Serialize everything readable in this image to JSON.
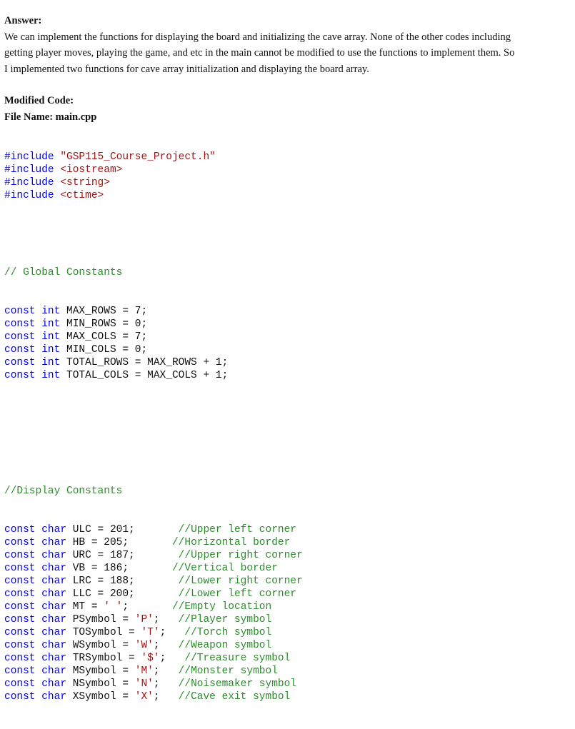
{
  "answer": {
    "heading": "Answer:",
    "paragraph_lines": [
      "We can implement the functions for displaying the board and initializing the cave array. None of the other codes including",
      "getting player moves, playing the game, and etc in the main cannot be modified to use the functions to implement them. So",
      "I implemented two functions for cave array initialization and displaying the board array."
    ]
  },
  "modified": {
    "heading": "Modified Code:",
    "file_name": "File Name: main.cpp"
  },
  "includes": [
    {
      "directive": "#include",
      "target": "\"GSP115_Course_Project.h\""
    },
    {
      "directive": "#include",
      "target": "<iostream>"
    },
    {
      "directive": "#include",
      "target": "<string>"
    },
    {
      "directive": "#include",
      "target": "<ctime>"
    }
  ],
  "global_comment": "// Global Constants",
  "globals": [
    {
      "kw1": "const",
      "kw2": "int",
      "rest": " MAX_ROWS = 7;"
    },
    {
      "kw1": "const",
      "kw2": "int",
      "rest": " MIN_ROWS = 0;"
    },
    {
      "kw1": "const",
      "kw2": "int",
      "rest": " MAX_COLS = 7;"
    },
    {
      "kw1": "const",
      "kw2": "int",
      "rest": " MIN_COLS = 0;"
    },
    {
      "kw1": "const",
      "kw2": "int",
      "rest": " TOTAL_ROWS = MAX_ROWS + 1;"
    },
    {
      "kw1": "const",
      "kw2": "int",
      "rest": " TOTAL_COLS = MAX_COLS + 1;"
    }
  ],
  "display_comment": "//Display Constants",
  "display": [
    {
      "kw1": "const",
      "kw2": "char",
      "pre": " ULC = 201;",
      "lit": "",
      "post": "",
      "pad": "       ",
      "comment": "//Upper left corner"
    },
    {
      "kw1": "const",
      "kw2": "char",
      "pre": " HB = 205;",
      "lit": "",
      "post": "",
      "pad": "       ",
      "comment": "//Horizontal border"
    },
    {
      "kw1": "const",
      "kw2": "char",
      "pre": " URC = 187;",
      "lit": "",
      "post": "",
      "pad": "       ",
      "comment": "//Upper right corner"
    },
    {
      "kw1": "const",
      "kw2": "char",
      "pre": " VB = 186;",
      "lit": "",
      "post": "",
      "pad": "       ",
      "comment": "//Vertical border"
    },
    {
      "kw1": "const",
      "kw2": "char",
      "pre": " LRC = 188;",
      "lit": "",
      "post": "",
      "pad": "       ",
      "comment": "//Lower right corner"
    },
    {
      "kw1": "const",
      "kw2": "char",
      "pre": " LLC = 200;",
      "lit": "",
      "post": "",
      "pad": "       ",
      "comment": "//Lower left corner"
    },
    {
      "kw1": "const",
      "kw2": "char",
      "pre": " MT = ",
      "lit": "' '",
      "post": ";",
      "pad": "       ",
      "comment": "//Empty location"
    },
    {
      "kw1": "const",
      "kw2": "char",
      "pre": " PSymbol = ",
      "lit": "'P'",
      "post": ";",
      "pad": "   ",
      "comment": "//Player symbol"
    },
    {
      "kw1": "const",
      "kw2": "char",
      "pre": " TOSymbol = ",
      "lit": "'T'",
      "post": ";",
      "pad": "   ",
      "comment": "//Torch symbol"
    },
    {
      "kw1": "const",
      "kw2": "char",
      "pre": " WSymbol = ",
      "lit": "'W'",
      "post": ";",
      "pad": "   ",
      "comment": "//Weapon symbol"
    },
    {
      "kw1": "const",
      "kw2": "char",
      "pre": " TRSymbol = ",
      "lit": "'$'",
      "post": ";",
      "pad": "   ",
      "comment": "//Treasure symbol"
    },
    {
      "kw1": "const",
      "kw2": "char",
      "pre": " MSymbol = ",
      "lit": "'M'",
      "post": ";",
      "pad": "   ",
      "comment": "//Monster symbol"
    },
    {
      "kw1": "const",
      "kw2": "char",
      "pre": " NSymbol = ",
      "lit": "'N'",
      "post": ";",
      "pad": "   ",
      "comment": "//Noisemaker symbol"
    },
    {
      "kw1": "const",
      "kw2": "char",
      "pre": " XSymbol = ",
      "lit": "'X'",
      "post": ";",
      "pad": "   ",
      "comment": "//Cave exit symbol"
    }
  ]
}
